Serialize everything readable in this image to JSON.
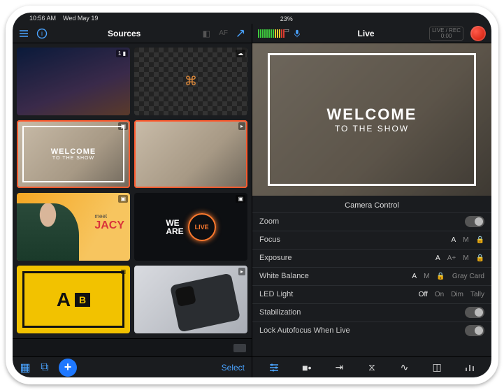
{
  "statusbar": {
    "time": "10:56 AM",
    "date": "Wed May 19",
    "battery": "23%"
  },
  "left": {
    "title": "Sources",
    "footer": {
      "select": "Select"
    }
  },
  "thumbs": {
    "t2_icon": "⌘",
    "t3_line1": "WELCOME",
    "t3_line2": "TO THE SHOW",
    "t5_meet": "meet",
    "t5_name": "JACY",
    "t6_we": "WE",
    "t6_are": "ARE",
    "t6_live": "LIVE",
    "t7_a": "A",
    "t7_b": "B"
  },
  "right": {
    "title": "Live",
    "rec_label": "LIVE / REC",
    "rec_time": "0:00"
  },
  "preview": {
    "line1": "WELCOME",
    "line2": "TO THE SHOW"
  },
  "section": "Camera Control",
  "controls": {
    "zoom": "Zoom",
    "focus": "Focus",
    "focus_opts": {
      "a": "A",
      "m": "M"
    },
    "exposure": "Exposure",
    "exposure_opts": {
      "a": "A",
      "ap": "A+",
      "m": "M"
    },
    "wb": "White Balance",
    "wb_opts": {
      "a": "A",
      "m": "M",
      "gray": "Gray Card"
    },
    "led": "LED Light",
    "led_opts": {
      "off": "Off",
      "on": "On",
      "dim": "Dim",
      "tally": "Tally"
    },
    "stab": "Stabilization",
    "lockaf": "Lock Autofocus When Live"
  }
}
